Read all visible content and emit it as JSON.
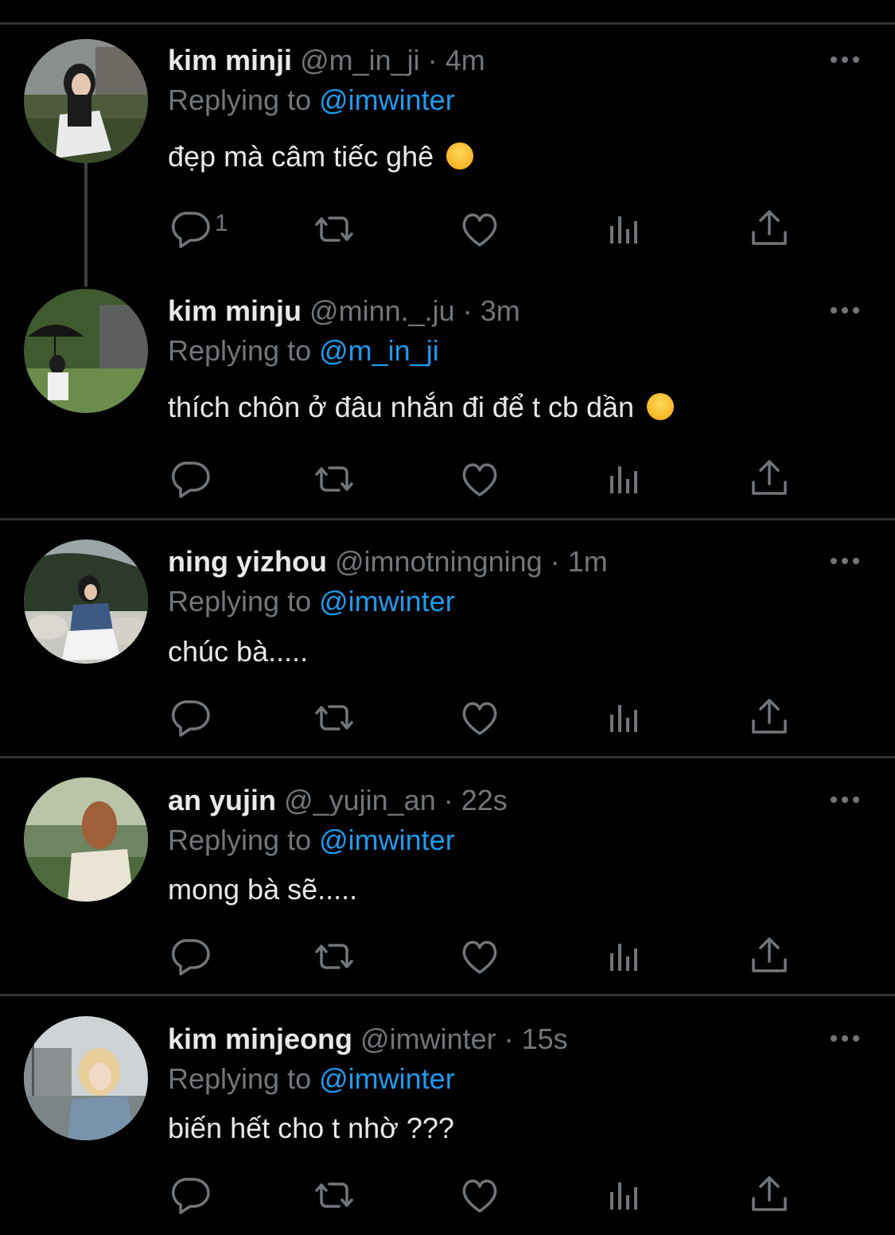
{
  "colors": {
    "background": "#000000",
    "text": "#e7e9ea",
    "muted": "#71767b",
    "mention": "#1d9bf0",
    "divider": "#2f3336"
  },
  "labels": {
    "replying_to": "Replying to"
  },
  "icons": {
    "more": "more-horizontal-icon",
    "reply": "reply-bubble-icon",
    "retweet": "retweet-icon",
    "like": "heart-icon",
    "views": "analytics-bars-icon",
    "share": "share-upload-icon"
  },
  "tweets": [
    {
      "name": "kim minji",
      "handle": "@m_in_ji",
      "separator": "·",
      "time": "4m",
      "replying_to": "@imwinter",
      "text": "đẹp mà câm tiếc ghê",
      "emoji": "crying-face",
      "reply_count": "1"
    },
    {
      "name": "kim minju",
      "handle": "@minn._.ju",
      "separator": "·",
      "time": "3m",
      "replying_to": "@m_in_ji",
      "text": "thích chôn ở đâu nhắn đi để t cb dần",
      "emoji": "smiling-face-with-halo",
      "reply_count": ""
    },
    {
      "name": "ning yizhou",
      "handle": "@imnotningning",
      "separator": "·",
      "time": "1m",
      "replying_to": "@imwinter",
      "text": "chúc bà.....",
      "reply_count": ""
    },
    {
      "name": "an yujin",
      "handle": "@_yujin_an",
      "separator": "·",
      "time": "22s",
      "replying_to": "@imwinter",
      "text": "mong bà sẽ.....",
      "reply_count": ""
    },
    {
      "name": "kim minjeong",
      "handle": "@imwinter",
      "separator": "·",
      "time": "15s",
      "replying_to": "@imwinter",
      "text": "biến hết cho t nhờ ???",
      "reply_count": ""
    }
  ]
}
